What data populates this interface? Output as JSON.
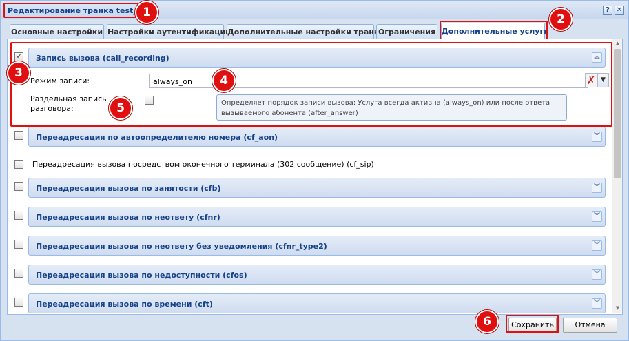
{
  "window": {
    "title": "Редактирование транка test_sip",
    "help_icon": "help-icon",
    "close_icon": "close-icon"
  },
  "tabs": [
    {
      "label": "Основные настройки",
      "active": false
    },
    {
      "label": "Настройки аутентификации",
      "active": false
    },
    {
      "label": "Дополнительные настройки транка",
      "active": false
    },
    {
      "label": "Ограничения",
      "active": false
    },
    {
      "label": "Дополнительные услуги",
      "active": true
    }
  ],
  "services": {
    "call_recording": {
      "title": "Запись вызова (call_recording)",
      "checked": true,
      "expanded": true,
      "mode_label": "Режим записи:",
      "mode_value": "always_on",
      "split_label_line1": "Раздельная запись",
      "split_label_line2": "разговора:",
      "tooltip_line1": "Определяет порядок записи вызова: Услуга всегда активна (always_on) или после ответа",
      "tooltip_line2": "вызываемого абонента (after_answer)"
    },
    "cf_aon": "Переадресация по автоопределителю номера (cf_aon)",
    "cf_sip": "Переадресация вызова посредством оконечного терминала (302 сообщение) (cf_sip)",
    "cfb": "Переадресация вызова по занятости (cfb)",
    "cfnr": "Переадресация вызова по неответу (cfnr)",
    "cfnr_type2": "Переадресация вызова по неответу без уведомления (cfnr_type2)",
    "cfos": "Переадресация вызова по недоступности (cfos)",
    "cft": "Переадресация вызова по времени (cft)"
  },
  "buttons": {
    "save": "Сохранить",
    "cancel": "Отмена"
  },
  "markers": [
    "1",
    "2",
    "3",
    "4",
    "5",
    "6"
  ],
  "colors": {
    "highlight": "#e01010",
    "header_text": "#15428b",
    "border": "#99bbe8"
  }
}
